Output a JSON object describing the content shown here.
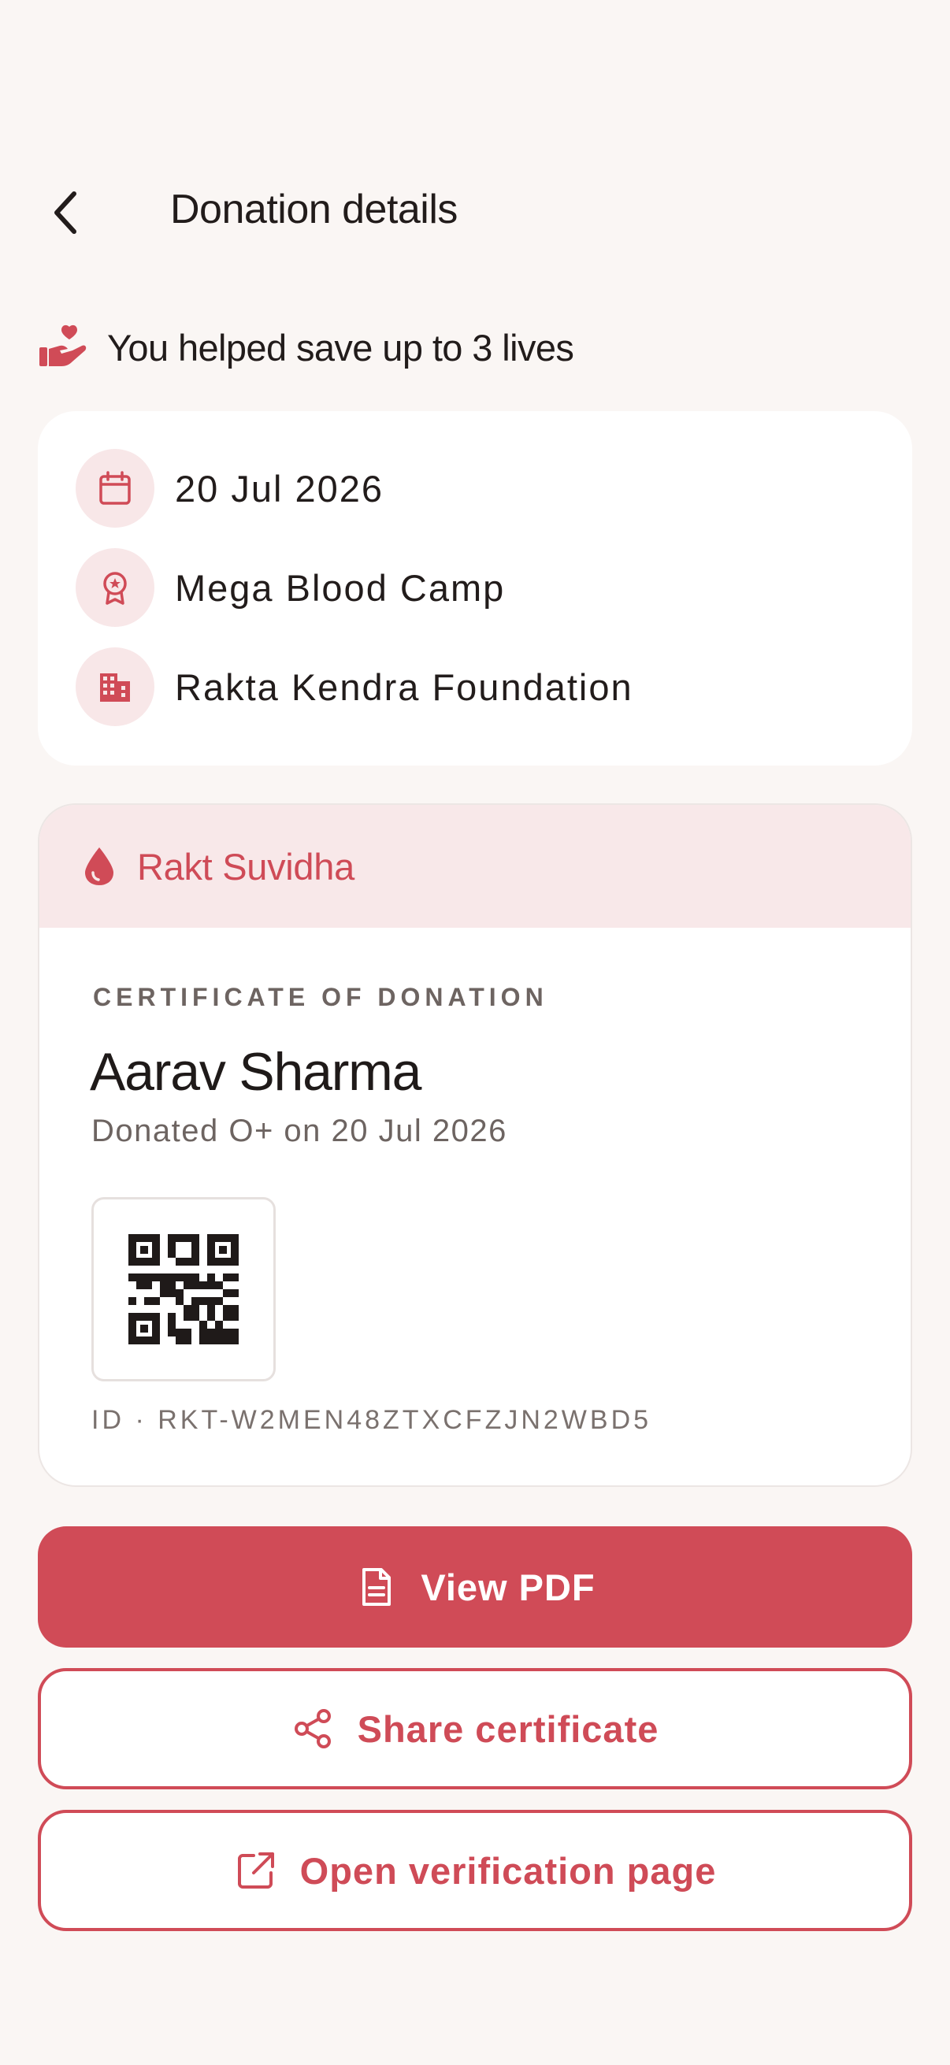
{
  "colors": {
    "accent": "#d04b57",
    "accent_soft": "#f8e7e8",
    "background": "#faf6f4",
    "card": "#ffffff",
    "text": "#221c1b",
    "muted": "#6d6461"
  },
  "header": {
    "back_icon": "chevron-left-icon",
    "title": "Donation details"
  },
  "impact": {
    "icon": "hand-heart-icon",
    "text": "You helped save up to 3 lives"
  },
  "info": {
    "date": {
      "icon": "calendar-icon",
      "text": "20 Jul 2026"
    },
    "camp": {
      "icon": "award-badge-icon",
      "text": "Mega Blood Camp"
    },
    "organization": {
      "icon": "building-icon",
      "text": "Rakta Kendra Foundation"
    }
  },
  "certificate": {
    "brand_icon": "blood-drop-icon",
    "brand": "Rakt Suvidha",
    "eyebrow": "CERTIFICATE OF DONATION",
    "donor_name": "Aarav Sharma",
    "subtitle": "Donated O+ on 20 Jul 2026",
    "qr_icon": "qr-code-icon",
    "id_text": "ID · RKT-W2MEN48ZTXCFZJN2WBD5"
  },
  "actions": {
    "view_pdf": {
      "icon": "file-text-icon",
      "label": "View PDF"
    },
    "share": {
      "icon": "share-icon",
      "label": "Share certificate"
    },
    "verify": {
      "icon": "external-link-icon",
      "label": "Open verification page"
    }
  }
}
